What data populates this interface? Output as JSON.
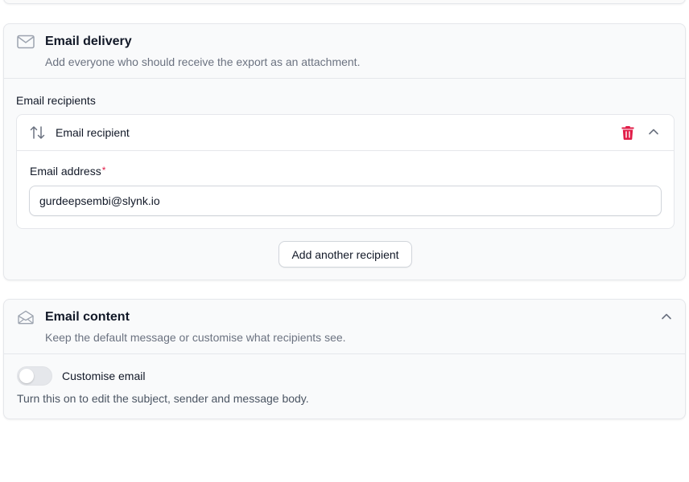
{
  "delivery": {
    "icon": "envelope-icon",
    "title": "Email delivery",
    "description": "Add everyone who should receive the export as an attachment.",
    "recipients_label": "Email recipients",
    "recipient": {
      "title": "Email recipient",
      "drag_icon": "arrows-up-down-icon",
      "delete_icon": "trash-icon",
      "collapse_icon": "chevron-up-icon",
      "address_label": "Email address",
      "required_mark": "*",
      "address_value": "gurdeepsembi@slynk.io"
    },
    "add_button_label": "Add another recipient"
  },
  "content": {
    "icon": "envelope-open-icon",
    "title": "Email content",
    "description": "Keep the default message or customise what recipients see.",
    "collapse_icon": "chevron-up-icon",
    "toggle_label": "Customise email",
    "toggle_on": false,
    "toggle_help": "Turn this on to edit the subject, sender and message body."
  },
  "colors": {
    "danger": "#e11d48",
    "border": "#e5e7eb",
    "muted_text": "#6b7280"
  }
}
